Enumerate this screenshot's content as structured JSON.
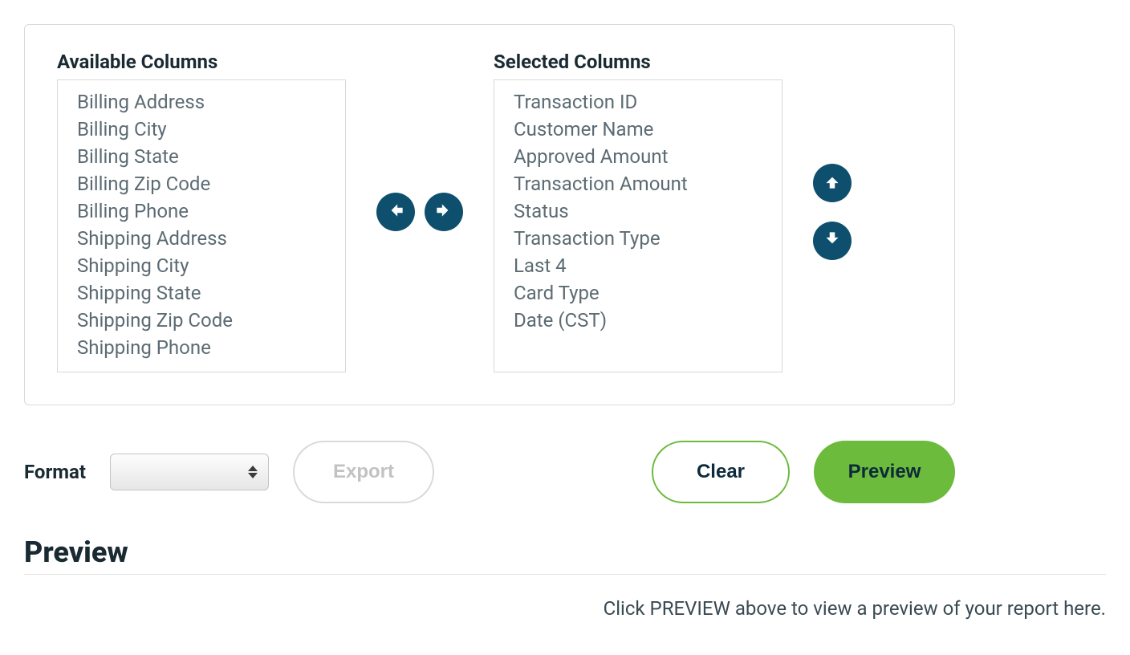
{
  "columns": {
    "available_label": "Available Columns",
    "selected_label": "Selected Columns",
    "available": [
      "Billing Address",
      "Billing City",
      "Billing State",
      "Billing Zip Code",
      "Billing Phone",
      "Shipping Address",
      "Shipping City",
      "Shipping State",
      "Shipping Zip Code",
      "Shipping Phone"
    ],
    "selected": [
      "Transaction ID",
      "Customer Name",
      "Approved Amount",
      "Transaction Amount",
      "Status",
      "Transaction Type",
      "Last 4",
      "Card Type",
      "Date (CST)"
    ]
  },
  "actions": {
    "format_label": "Format",
    "format_value": "",
    "export_label": "Export",
    "clear_label": "Clear",
    "preview_label": "Preview"
  },
  "preview": {
    "heading": "Preview",
    "hint": "Click PREVIEW above to view a preview of your report here."
  },
  "colors": {
    "accent_dark": "#0d4f6c",
    "accent_green": "#6cbb3c"
  }
}
